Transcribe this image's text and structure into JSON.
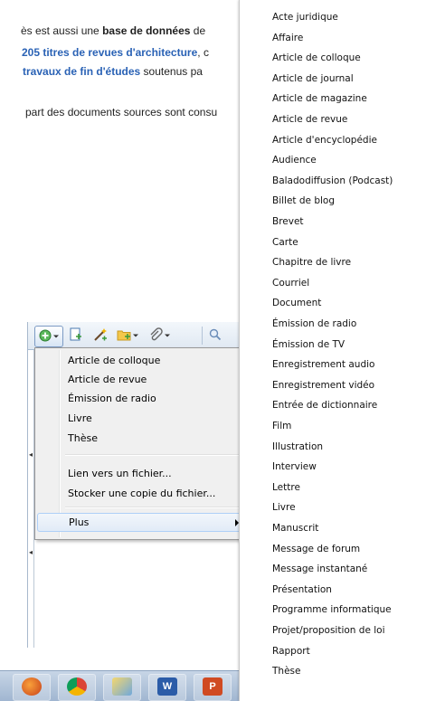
{
  "article": {
    "line1_prefix": "ès est aussi une ",
    "line1_bold": "base de données",
    "line1_suffix": " de",
    "line2_link": "205 titres de revues d'architecture",
    "line2_suffix": ", c",
    "line3_bold": " travaux de fin d'études",
    "line3_suffix": " soutenus pa",
    "line4": "part des documents sources sont consu"
  },
  "toolbar": {
    "icons": [
      "new-item-icon",
      "new-note-icon",
      "wand-icon",
      "folder-icon",
      "attach-icon",
      "search-icon"
    ]
  },
  "context_menu": {
    "items": [
      {
        "label": "Article de colloque"
      },
      {
        "label": "Article de revue"
      },
      {
        "label": "Émission de radio"
      },
      {
        "label": "Livre"
      },
      {
        "label": "Thèse"
      }
    ],
    "link_file": "Lien vers un fichier...",
    "store_copy": "Stocker une copie du fichier...",
    "more": "Plus"
  },
  "submenu": {
    "items": [
      "Acte juridique",
      "Affaire",
      "Article de colloque",
      "Article de journal",
      "Article de magazine",
      "Article de revue",
      "Article d'encyclopédie",
      "Audience",
      "Baladodiffusion (Podcast)",
      "Billet de blog",
      "Brevet",
      "Carte",
      "Chapitre de livre",
      "Courriel",
      "Document",
      "Émission de radio",
      "Émission de TV",
      "Enregistrement audio",
      "Enregistrement vidéo",
      "Entrée de dictionnaire",
      "Film",
      "Illustration",
      "Interview",
      "Lettre",
      "Livre",
      "Manuscrit",
      "Message de forum",
      "Message instantané",
      "Présentation",
      "Programme informatique",
      "Projet/proposition de loi",
      "Rapport",
      "Thèse"
    ]
  },
  "taskbar": {
    "apps": [
      "firefox-icon",
      "chrome-icon",
      "paint-icon",
      "word-icon",
      "powerpoint-icon"
    ],
    "word_letter": "W",
    "ppt_letter": "P"
  },
  "colors": {
    "link": "#2a62b5",
    "menu_bg": "#f0f0f0",
    "hover_border": "#aecff7"
  }
}
